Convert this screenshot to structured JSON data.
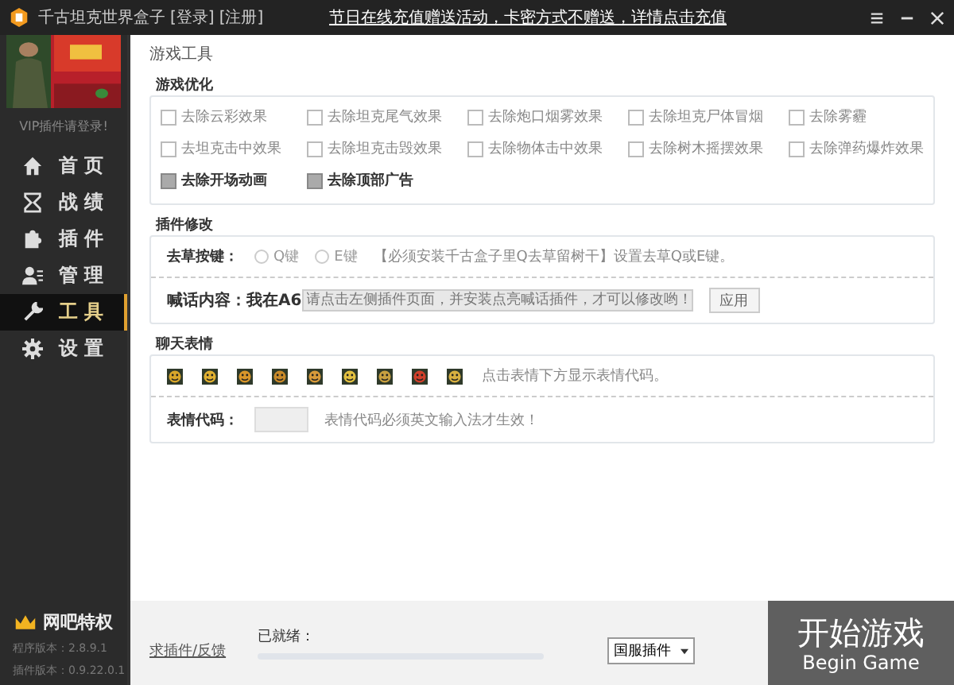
{
  "window": {
    "title": "千古坦克世界盒子",
    "login": "[登录]",
    "register": "[注册]",
    "notice": "节日在线充值赠送活动，卡密方式不赠送，详情点击充值"
  },
  "sidebar": {
    "login_hint": "VIP插件请登录!",
    "items": [
      {
        "label": "首 页",
        "kind": "home",
        "selected": false
      },
      {
        "label": "战 绩",
        "kind": "stats",
        "selected": false
      },
      {
        "label": "插 件",
        "kind": "plugin",
        "selected": false
      },
      {
        "label": "管 理",
        "kind": "manage",
        "selected": false
      },
      {
        "label": "工 具",
        "kind": "tool",
        "selected": true
      },
      {
        "label": "设 置",
        "kind": "gear",
        "selected": false
      }
    ],
    "vip": "网吧特权",
    "program_version": "程序版本：2.8.9.1",
    "plugin_version": "插件版本：0.9.22.0.1"
  },
  "page_title": "游戏工具",
  "optimize": {
    "title": "游戏优化",
    "options": [
      {
        "label": "去除云彩效果",
        "checked": false
      },
      {
        "label": "去除坦克尾气效果",
        "checked": false
      },
      {
        "label": "去除炮口烟雾效果",
        "checked": false
      },
      {
        "label": "去除坦克尸体冒烟",
        "checked": false
      },
      {
        "label": "去除雾霾",
        "checked": false
      },
      {
        "label": "去坦克击中效果",
        "checked": false
      },
      {
        "label": "去除坦克击毁效果",
        "checked": false
      },
      {
        "label": "去除物体击中效果",
        "checked": false
      },
      {
        "label": "去除树木摇摆效果",
        "checked": false
      },
      {
        "label": "去除弹药爆炸效果",
        "checked": false
      },
      {
        "label": "去除开场动画",
        "checked": true
      },
      {
        "label": "去除顶部广告",
        "checked": true
      }
    ]
  },
  "plugin_edit": {
    "title": "插件修改",
    "grass_label": "去草按键：",
    "keys": [
      {
        "label": "Q键",
        "selected": false
      },
      {
        "label": "E键",
        "selected": false
      }
    ],
    "note": "【必须安装千古盒子里Q去草留树干】设置去草Q或E键。",
    "shout_label": "喊话内容：",
    "shout_prefix": "我在A6",
    "shout_placeholder": "请点击左侧插件页面，并安装点亮喊话插件，才可以修改哟！",
    "apply": "应用"
  },
  "chat_emotes": {
    "title": "聊天表情",
    "emotes": [
      {
        "color": "#d8a62a"
      },
      {
        "color": "#e0b030"
      },
      {
        "color": "#d9962a"
      },
      {
        "color": "#c98a2a"
      },
      {
        "color": "#d89a3a"
      },
      {
        "color": "#e2c040"
      },
      {
        "color": "#c8a040"
      },
      {
        "color": "#d0402a"
      },
      {
        "color": "#d8b040"
      }
    ],
    "hint": "点击表情下方显示表情代码。",
    "code_label": "表情代码：",
    "code_hint": "表情代码必须英文输入法才生效！"
  },
  "bottom": {
    "feedback": "求插件/反馈",
    "status": "已就绪：",
    "level": 0,
    "server": "国服插件",
    "start": "开始游戏",
    "start_en": "Begin Game"
  }
}
